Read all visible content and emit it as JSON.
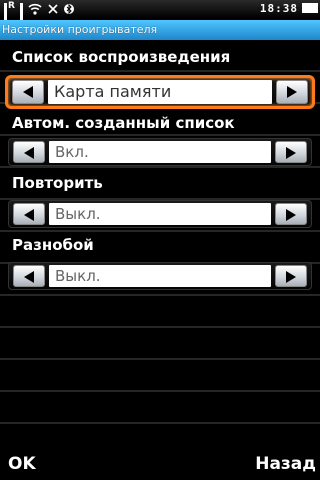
{
  "status_bar": {
    "time": "18:38",
    "network_label": "R"
  },
  "title": "Настройки проигрывателя",
  "settings": [
    {
      "label": "Список воспроизведения",
      "value": "Карта памяти"
    },
    {
      "label": "Автом. созданный список",
      "value": "Вкл."
    },
    {
      "label": "Повторить",
      "value": "Выкл."
    },
    {
      "label": "Разнобой",
      "value": "Выкл."
    }
  ],
  "softkeys": {
    "left": "OK",
    "right": "Назад"
  },
  "colors": {
    "title_bar": "#35aef0",
    "focus_border": "#ff7a1a"
  }
}
